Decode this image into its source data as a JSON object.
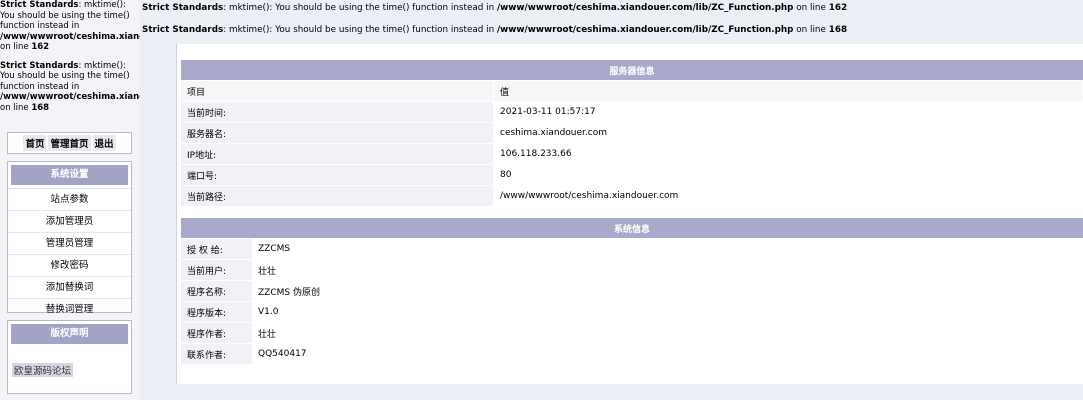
{
  "warnings": {
    "left1": {
      "label": "Strict Standards",
      "text": ": mktime(): You should be using the time() function instead in ",
      "path": "/www/wwwroot/ceshima.xiando",
      "tail": " on line ",
      "line": "162"
    },
    "left2": {
      "label": "Strict Standards",
      "text": ": mktime(): You should be using the time() function instead in ",
      "path": "/www/wwwroot/ceshima.xiando",
      "tail": " on line ",
      "line": "168"
    },
    "main1": {
      "label": "Strict Standards",
      "text": ": mktime(): You should be using the time() function instead in ",
      "path": "/www/wwwroot/ceshima.xiandouer.com/lib/ZC_Function.php",
      "tail": " on line ",
      "line": "162"
    },
    "main2": {
      "label": "Strict Standards",
      "text": ": mktime(): You should be using the time() function instead in ",
      "path": "/www/wwwroot/ceshima.xiandouer.com/lib/ZC_Function.php",
      "tail": " on line ",
      "line": "168"
    }
  },
  "topnav": {
    "home": "首页",
    "admin_home": "管理首页",
    "logout": "退出"
  },
  "sidebar": {
    "settings_title": "系统设置",
    "items": [
      "站点参数",
      "添加管理员",
      "管理员管理",
      "修改密码",
      "添加替换词",
      "替换词管理"
    ],
    "copyright_title": "版权声明",
    "copyright_link": "欧皇源码论坛"
  },
  "server": {
    "title": "服务器信息",
    "header": {
      "key": "项目",
      "value": "值"
    },
    "rows": [
      {
        "key": "当前时间:",
        "value": "2021-03-11 01:57:17"
      },
      {
        "key": "服务器名:",
        "value": "ceshima.xiandouer.com"
      },
      {
        "key": "IP地址:",
        "value": "106.118.233.66"
      },
      {
        "key": "端口号:",
        "value": "80"
      },
      {
        "key": "当前路径:",
        "value": "/www/wwwroot/ceshima.xiandouer.com"
      }
    ]
  },
  "system": {
    "title": "系统信息",
    "rows": [
      {
        "key": "授 权 给:",
        "value": "ZZCMS"
      },
      {
        "key": "当前用户:",
        "value": "壮壮"
      },
      {
        "key": "程序名称:",
        "value": "ZZCMS 伪原创"
      },
      {
        "key": "程序版本:",
        "value": "V1.0"
      },
      {
        "key": "程序作者:",
        "value": "壮壮"
      },
      {
        "key": "联系作者:",
        "value": "QQ540417"
      }
    ]
  }
}
